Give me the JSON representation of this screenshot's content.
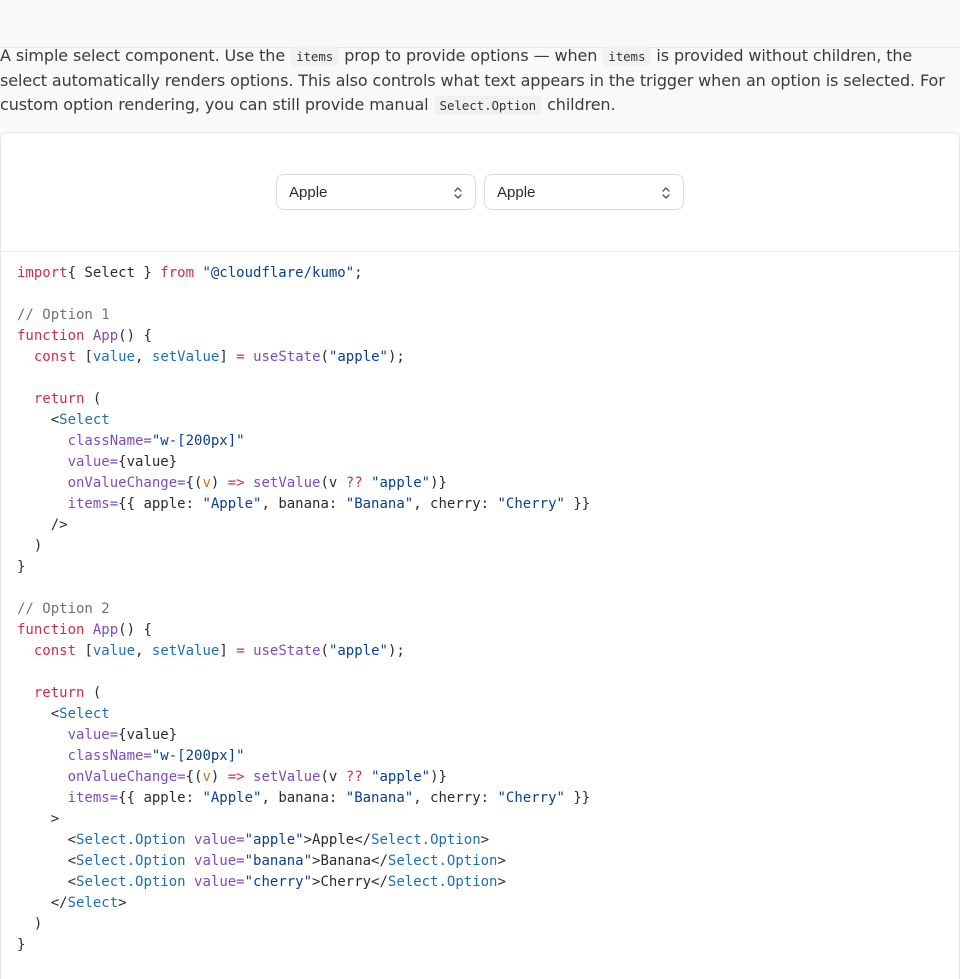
{
  "description": {
    "p1": "A simple select component. Use the",
    "code1": "items",
    "p2": "prop to provide options — when",
    "code2": "items",
    "p3": "is provided without children, the select automatically renders options. This also controls what text appears in the trigger when an option is selected. For custom option rendering, you can still provide manual",
    "code3": "Select.Option",
    "p4": "children."
  },
  "preview": {
    "select1_value": "Apple",
    "select2_value": "Apple"
  },
  "code_lines": [
    [
      [
        "kw",
        "import"
      ],
      [
        "",
        "{ Select } "
      ],
      [
        "kw",
        "from"
      ],
      [
        "",
        ""
      ],
      [
        "str",
        " \"@cloudflare/kumo\""
      ],
      [
        "",
        ";"
      ]
    ],
    [],
    [
      [
        "cm",
        "// Option 1"
      ]
    ],
    [
      [
        "kw",
        "function"
      ],
      [
        "",
        " "
      ],
      [
        "fn",
        "App"
      ],
      [
        "",
        "() {"
      ]
    ],
    [
      [
        "",
        "  "
      ],
      [
        "kw",
        "const"
      ],
      [
        "",
        " ["
      ],
      [
        "var",
        "value"
      ],
      [
        "",
        ", "
      ],
      [
        "var",
        "setValue"
      ],
      [
        "",
        "] "
      ],
      [
        "op",
        "="
      ],
      [
        "",
        " "
      ],
      [
        "fn",
        "useState"
      ],
      [
        "",
        "("
      ],
      [
        "str",
        "\"apple\""
      ],
      [
        "",
        ");"
      ]
    ],
    [],
    [
      [
        "",
        "  "
      ],
      [
        "kw",
        "return"
      ],
      [
        "",
        " ("
      ]
    ],
    [
      [
        "",
        "    <"
      ],
      [
        "tag",
        "Select"
      ]
    ],
    [
      [
        "",
        "      "
      ],
      [
        "attr",
        "className="
      ],
      [
        "str",
        "\"w-[200px]\""
      ]
    ],
    [
      [
        "",
        "      "
      ],
      [
        "attr",
        "value="
      ],
      [
        "",
        "{value}"
      ]
    ],
    [
      [
        "",
        "      "
      ],
      [
        "attr",
        "onValueChange="
      ],
      [
        "",
        "{("
      ],
      [
        "param",
        "v"
      ],
      [
        "",
        ") "
      ],
      [
        "op",
        "=>"
      ],
      [
        "",
        " "
      ],
      [
        "fn",
        "setValue"
      ],
      [
        "",
        "(v "
      ],
      [
        "op",
        "??"
      ],
      [
        "",
        " "
      ],
      [
        "str",
        "\"apple\""
      ],
      [
        "",
        ")}"
      ]
    ],
    [
      [
        "",
        "      "
      ],
      [
        "attr",
        "items="
      ],
      [
        "",
        "{{ apple: "
      ],
      [
        "str",
        "\"Apple\""
      ],
      [
        "",
        ", banana: "
      ],
      [
        "str",
        "\"Banana\""
      ],
      [
        "",
        ", cherry: "
      ],
      [
        "str",
        "\"Cherry\""
      ],
      [
        "",
        " }}"
      ]
    ],
    [
      [
        "",
        "    />"
      ]
    ],
    [
      [
        "",
        "  )"
      ]
    ],
    [
      [
        "",
        "}"
      ]
    ],
    [],
    [
      [
        "cm",
        "// Option 2"
      ]
    ],
    [
      [
        "kw",
        "function"
      ],
      [
        "",
        " "
      ],
      [
        "fn",
        "App"
      ],
      [
        "",
        "() {"
      ]
    ],
    [
      [
        "",
        "  "
      ],
      [
        "kw",
        "const"
      ],
      [
        "",
        " ["
      ],
      [
        "var",
        "value"
      ],
      [
        "",
        ", "
      ],
      [
        "var",
        "setValue"
      ],
      [
        "",
        "] "
      ],
      [
        "op",
        "="
      ],
      [
        "",
        " "
      ],
      [
        "fn",
        "useState"
      ],
      [
        "",
        "("
      ],
      [
        "str",
        "\"apple\""
      ],
      [
        "",
        ");"
      ]
    ],
    [],
    [
      [
        "",
        "  "
      ],
      [
        "kw",
        "return"
      ],
      [
        "",
        " ("
      ]
    ],
    [
      [
        "",
        "    <"
      ],
      [
        "tag",
        "Select"
      ]
    ],
    [
      [
        "",
        "      "
      ],
      [
        "attr",
        "value="
      ],
      [
        "",
        "{value}"
      ]
    ],
    [
      [
        "",
        "      "
      ],
      [
        "attr",
        "className="
      ],
      [
        "str",
        "\"w-[200px]\""
      ]
    ],
    [
      [
        "",
        "      "
      ],
      [
        "attr",
        "onValueChange="
      ],
      [
        "",
        "{("
      ],
      [
        "param",
        "v"
      ],
      [
        "",
        ") "
      ],
      [
        "op",
        "=>"
      ],
      [
        "",
        " "
      ],
      [
        "fn",
        "setValue"
      ],
      [
        "",
        "(v "
      ],
      [
        "op",
        "??"
      ],
      [
        "",
        " "
      ],
      [
        "str",
        "\"apple\""
      ],
      [
        "",
        ")}"
      ]
    ],
    [
      [
        "",
        "      "
      ],
      [
        "attr",
        "items="
      ],
      [
        "",
        "{{ apple: "
      ],
      [
        "str",
        "\"Apple\""
      ],
      [
        "",
        ", banana: "
      ],
      [
        "str",
        "\"Banana\""
      ],
      [
        "",
        ", cherry: "
      ],
      [
        "str",
        "\"Cherry\""
      ],
      [
        "",
        " }}"
      ]
    ],
    [
      [
        "",
        "    >"
      ]
    ],
    [
      [
        "",
        "      <"
      ],
      [
        "tag",
        "Select.Option"
      ],
      [
        "",
        " "
      ],
      [
        "attr",
        "value="
      ],
      [
        "str",
        "\"apple\""
      ],
      [
        "",
        ">Apple</"
      ],
      [
        "tag",
        "Select.Option"
      ],
      [
        "",
        ">"
      ]
    ],
    [
      [
        "",
        "      <"
      ],
      [
        "tag",
        "Select.Option"
      ],
      [
        "",
        " "
      ],
      [
        "attr",
        "value="
      ],
      [
        "str",
        "\"banana\""
      ],
      [
        "",
        ">Banana</"
      ],
      [
        "tag",
        "Select.Option"
      ],
      [
        "",
        ">"
      ]
    ],
    [
      [
        "",
        "      <"
      ],
      [
        "tag",
        "Select.Option"
      ],
      [
        "",
        " "
      ],
      [
        "attr",
        "value="
      ],
      [
        "str",
        "\"cherry\""
      ],
      [
        "",
        ">Cherry</"
      ],
      [
        "tag",
        "Select.Option"
      ],
      [
        "",
        ">"
      ]
    ],
    [
      [
        "",
        "    </"
      ],
      [
        "tag",
        "Select"
      ],
      [
        "",
        ">"
      ]
    ],
    [
      [
        "",
        "  )"
      ]
    ],
    [
      [
        "",
        "}"
      ]
    ]
  ]
}
